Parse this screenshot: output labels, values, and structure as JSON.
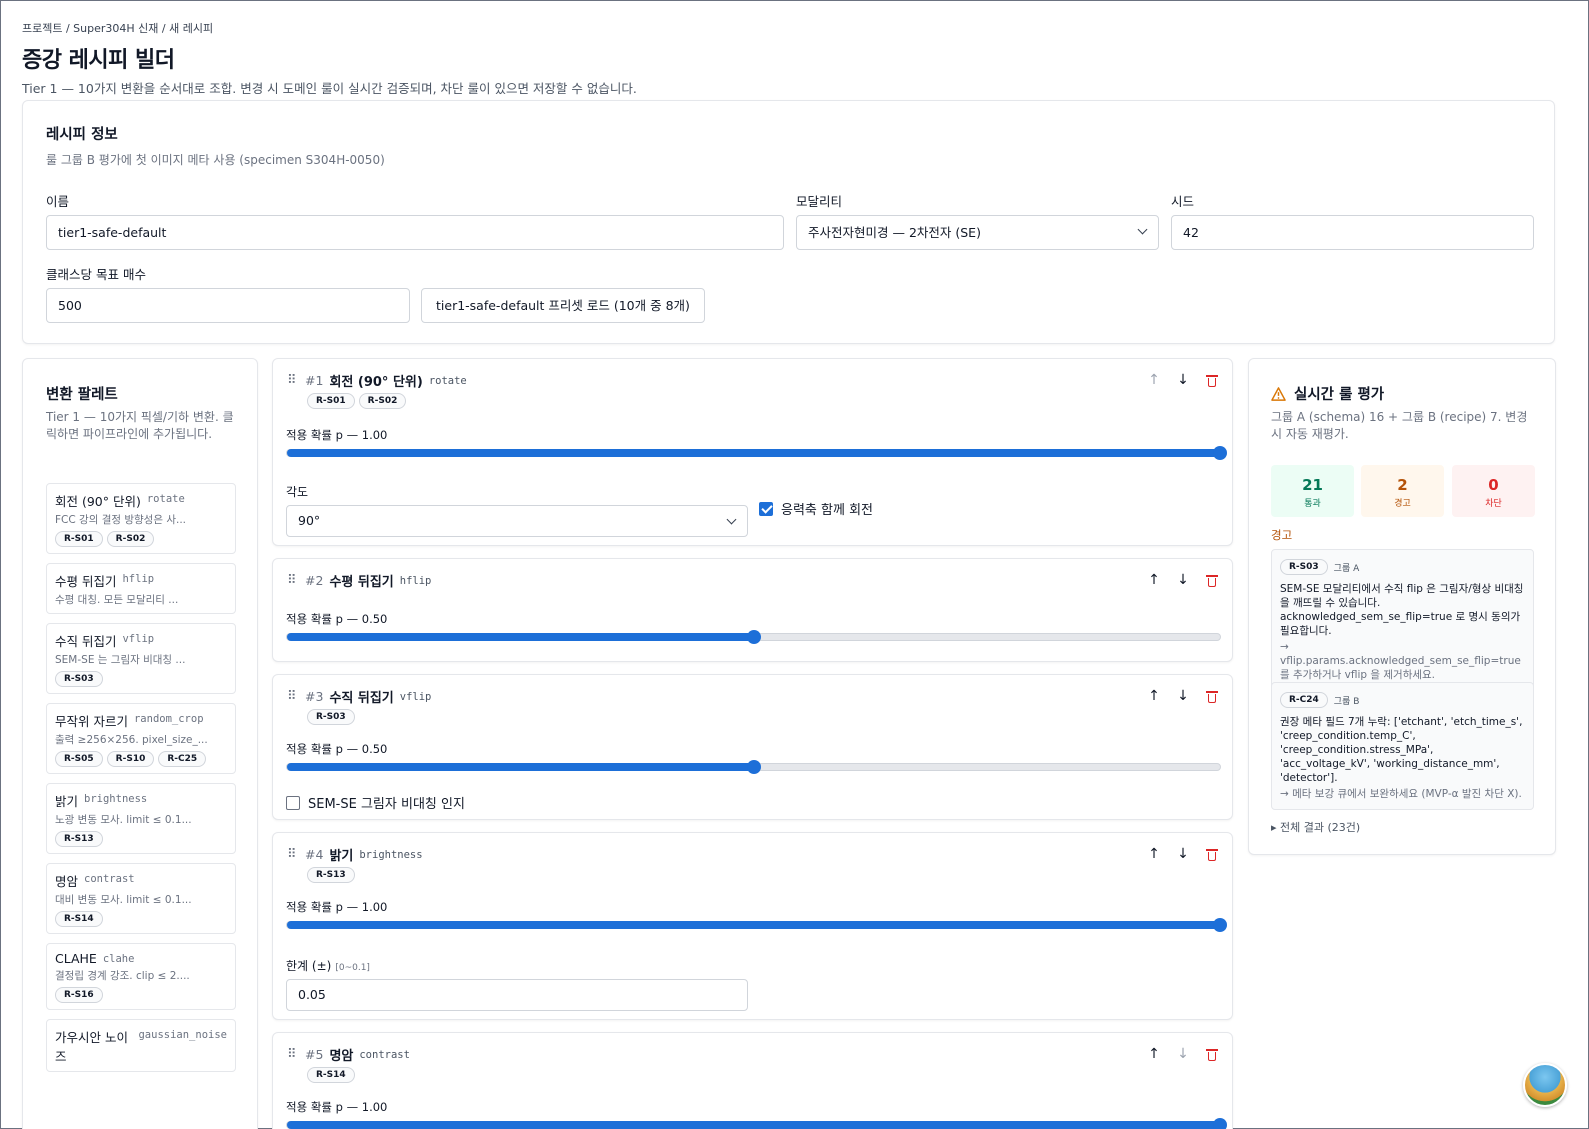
{
  "header": {
    "breadcrumb": "프로젝트 / Super304H 신재 / 새 레시피",
    "title": "증강 레시피 빌더",
    "subtitle": "Tier 1 — 10가지 변환을 순서대로 조합. 변경 시 도메인 룰이 실시간 검증되며, 차단 룰이 있으면 저장할 수 없습니다."
  },
  "info": {
    "title": "레시피 정보",
    "desc": "룰 그룹 B 평가에 첫 이미지 메타 사용 (specimen S304H-0050)",
    "name_label": "이름",
    "name_value": "tier1-safe-default",
    "modality_label": "모달리티",
    "modality_value": "주사전자현미경 — 2차전자 (SE)",
    "seed_label": "시드",
    "seed_value": "42",
    "target_label": "클래스당 목표 매수",
    "target_value": "500",
    "preset_button": "tier1-safe-default 프리셋 로드 (10개 중 8개)"
  },
  "palette": {
    "title": "변환 팔레트",
    "desc": "Tier 1 — 10가지 픽셀/기하 변환. 클릭하면 파이프라인에 추가됩니다.",
    "items": [
      {
        "name": "회전 (90° 단위)",
        "key": "rotate",
        "sub": "FCC 강의 결정 방향성은 사...",
        "badges": [
          "R-S01",
          "R-S02"
        ]
      },
      {
        "name": "수평 뒤집기",
        "key": "hflip",
        "sub": "수평 대칭. 모든 모달리티 ...",
        "badges": []
      },
      {
        "name": "수직 뒤집기",
        "key": "vflip",
        "sub": "SEM-SE 는 그림자 비대칭 ...",
        "badges": [
          "R-S03"
        ]
      },
      {
        "name": "무작위 자르기",
        "key": "random_crop",
        "sub": "출력 ≥256×256. pixel_size_...",
        "badges": [
          "R-S05",
          "R-S10",
          "R-C25"
        ]
      },
      {
        "name": "밝기",
        "key": "brightness",
        "sub": "노광 변동 모사. limit ≤ 0.1...",
        "badges": [
          "R-S13"
        ]
      },
      {
        "name": "명암",
        "key": "contrast",
        "sub": "대비 변동 모사. limit ≤ 0.1...",
        "badges": [
          "R-S14"
        ]
      },
      {
        "name": "CLAHE",
        "key": "clahe",
        "sub": "결정립 경계 강조. clip ≤ 2....",
        "badges": [
          "R-S16"
        ]
      },
      {
        "name": "가우시안 노이즈",
        "key": "gaussian_noise",
        "sub": "",
        "badges": []
      }
    ]
  },
  "pipeline": {
    "prob_prefix": "적용 확률 p — ",
    "steps": [
      {
        "num": "#1",
        "name": "회전 (90° 단위)",
        "key": "rotate",
        "badges": [
          "R-S01",
          "R-S02"
        ],
        "p_label": "1.00",
        "p": 1.0,
        "param_label": "각도",
        "param_value": "90°",
        "check_label": "응력축 함께 회전",
        "checked": true
      },
      {
        "num": "#2",
        "name": "수평 뒤집기",
        "key": "hflip",
        "badges": [],
        "p_label": "0.50",
        "p": 0.5
      },
      {
        "num": "#3",
        "name": "수직 뒤집기",
        "key": "vflip",
        "badges": [
          "R-S03"
        ],
        "p_label": "0.50",
        "p": 0.5,
        "check_label": "SEM-SE 그림자 비대칭 인지",
        "checked": false
      },
      {
        "num": "#4",
        "name": "밝기",
        "key": "brightness",
        "badges": [
          "R-S13"
        ],
        "p_label": "1.00",
        "p": 1.0,
        "param_label": "한계 (±)",
        "param_hint": "[0~0.1]",
        "param_value": "0.05"
      },
      {
        "num": "#5",
        "name": "명암",
        "key": "contrast",
        "badges": [
          "R-S14"
        ],
        "p_label": "1.00",
        "p": 1.0
      }
    ]
  },
  "rules": {
    "title": "실시간 룰 평가",
    "desc": "그룹 A (schema) 16 + 그룹 B (recipe) 7. 변경 시 자동 재평가.",
    "stats": [
      {
        "n": "21",
        "l": "통과",
        "bg": "#ecfdf5",
        "color": "#047857"
      },
      {
        "n": "2",
        "l": "경고",
        "bg": "#fff7ed",
        "color": "#b45309"
      },
      {
        "n": "0",
        "l": "차단",
        "bg": "#fef2f2",
        "color": "#dc2626"
      }
    ],
    "section": "경고",
    "warnings": [
      {
        "id": "R-S03",
        "group": "그룹 A",
        "msg": "SEM-SE 모달리티에서 수직 flip 은 그림자/형상 비대칭을 깨뜨릴 수 있습니다. acknowledged_sem_se_flip=true 로 명시 동의가 필요합니다.",
        "fix": "→ vflip.params.acknowledged_sem_se_flip=true 를 추가하거나 vflip 을 제거하세요."
      },
      {
        "id": "R-C24",
        "group": "그룹 B",
        "msg": "권장 메타 필드 7개 누락: ['etchant', 'etch_time_s', 'creep_condition.temp_C', 'creep_condition.stress_MPa', 'acc_voltage_kV', 'working_distance_mm', 'detector'].",
        "fix": "→ 메타 보강 큐에서 보완하세요 (MVP-α 발진 차단 X)."
      }
    ],
    "summary": "▸ 전체 결과 (23건)"
  }
}
